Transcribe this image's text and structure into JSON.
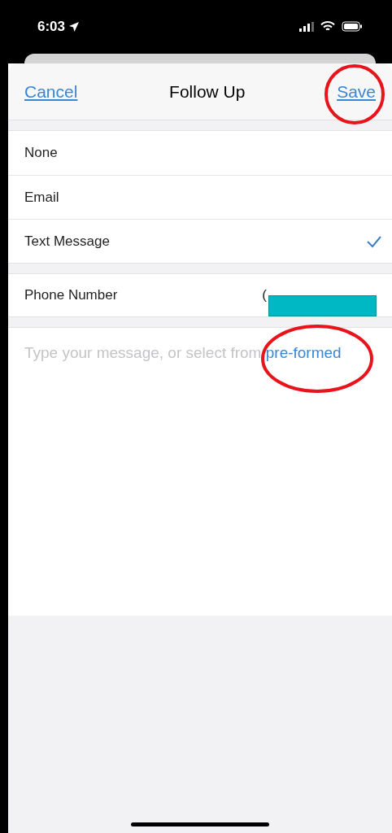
{
  "status_bar": {
    "time": "6:03"
  },
  "nav": {
    "cancel": "Cancel",
    "title": "Follow Up",
    "save": "Save"
  },
  "methods": [
    {
      "label": "None",
      "selected": false
    },
    {
      "label": "Email",
      "selected": false
    },
    {
      "label": "Text Message",
      "selected": true
    }
  ],
  "phone": {
    "label": "Phone Number",
    "value": "("
  },
  "message": {
    "placeholder": "Type your message, or select from",
    "link": "pre-formed"
  }
}
